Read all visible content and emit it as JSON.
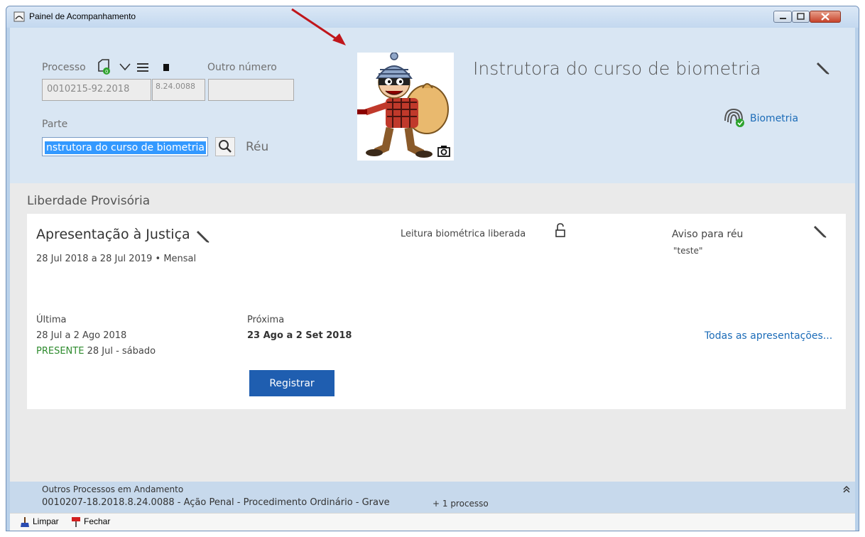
{
  "window": {
    "title": "Painel de Acompanhamento"
  },
  "header": {
    "processo_label": "Processo",
    "outro_numero_label": "Outro número",
    "processo_numero": "0010215-92.2018",
    "processo_sufixo": "8.24.0088",
    "outro_numero_value": "",
    "parte_label": "Parte",
    "parte_value": "nstrutora do curso de biometria",
    "reu_label": "Réu",
    "person_name": "Instrutora do curso de biometria",
    "biometria_label": "Biometria"
  },
  "section": {
    "title": "Liberdade Provisória"
  },
  "card": {
    "title": "Apresentação à Justiça",
    "period": "28 Jul 2018 a 28 Jul 2019 • Mensal",
    "biometric_status": "Leitura biométrica liberada",
    "aviso_label": "Aviso para réu",
    "aviso_value": "\"teste\"",
    "ultima_label": "Última",
    "ultima_period": "28 Jul a 2 Ago 2018",
    "ultima_status": "PRESENTE",
    "ultima_date": "28 Jul - sábado",
    "proxima_label": "Próxima",
    "proxima_period": "23 Ago a 2 Set 2018",
    "todas_link": "Todas as apresentações...",
    "register_label": "Registrar"
  },
  "bottom": {
    "title": "Outros Processos em Andamento",
    "process": "0010207-18.2018.8.24.0088 - Ação Penal - Procedimento Ordinário - Grave",
    "more": "+ 1 processo"
  },
  "toolbar": {
    "limpar": "Limpar",
    "fechar": "Fechar"
  },
  "colors": {
    "accent": "#1f5eb0",
    "link": "#1c6cb8",
    "present": "#2e8b2e",
    "annotation_arrow": "#c0161b"
  },
  "icons": [
    "window-icon",
    "document-icon",
    "chevron-down-icon",
    "menu-icon",
    "square-icon",
    "search-icon",
    "camera-icon",
    "pencil-icon",
    "fingerprint-icon",
    "unlock-icon",
    "double-chevron-up-icon",
    "broom-icon",
    "pin-icon"
  ]
}
